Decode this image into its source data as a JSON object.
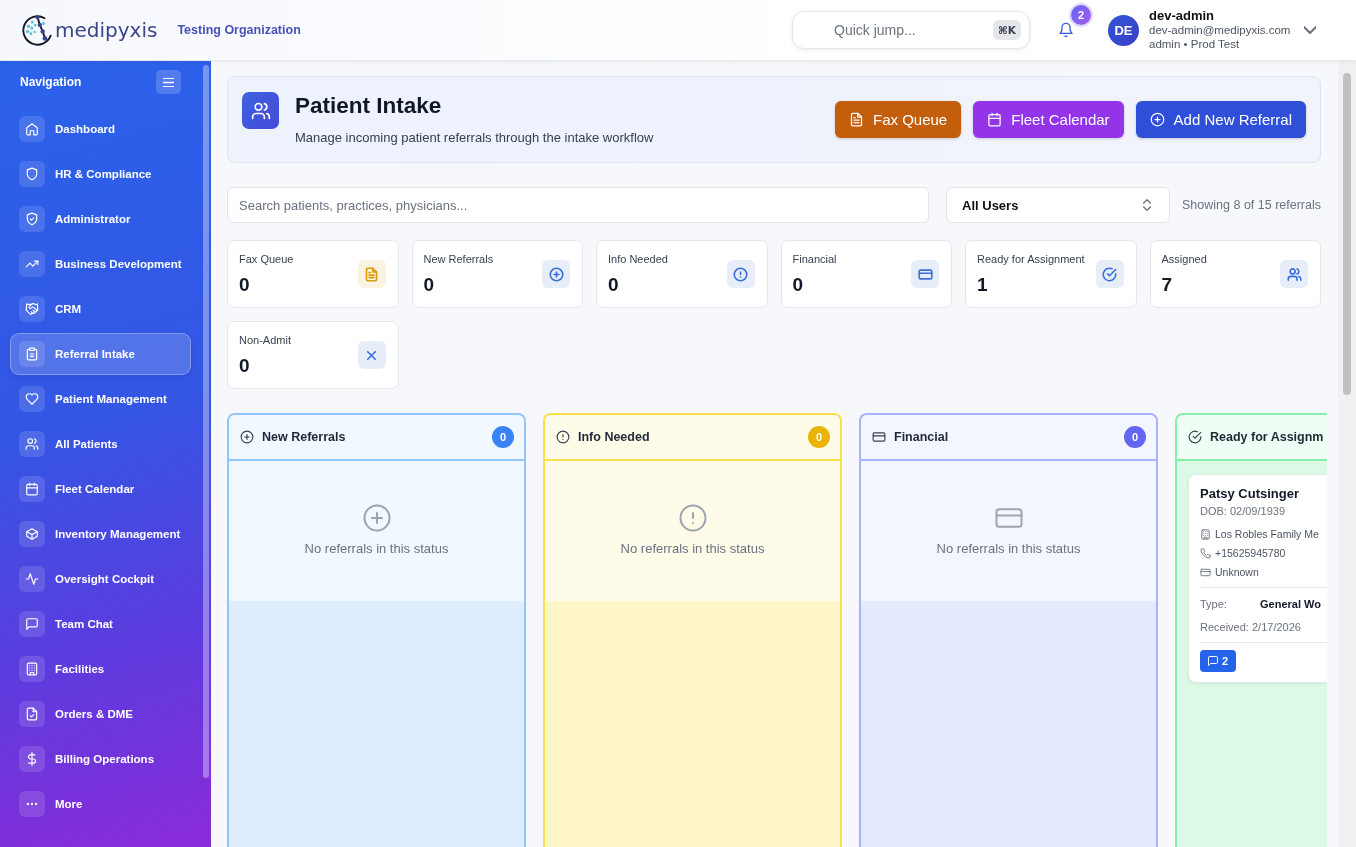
{
  "header": {
    "logo_text": "medipyxis",
    "organization": "Testing Organization",
    "quick_jump": {
      "placeholder": "Quick jump...",
      "shortcut": "⌘K"
    },
    "notifications": {
      "count": "2"
    },
    "user": {
      "initials": "DE",
      "name": "dev-admin",
      "email": "dev-admin@medipyxis.com",
      "role": "admin • Prod Test"
    }
  },
  "sidebar": {
    "title": "Navigation",
    "items": [
      {
        "label": "Dashboard",
        "selected": false
      },
      {
        "label": "HR & Compliance",
        "selected": false
      },
      {
        "label": "Administrator",
        "selected": false
      },
      {
        "label": "Business Development",
        "selected": false
      },
      {
        "label": "CRM",
        "selected": false
      },
      {
        "label": "Referral Intake",
        "selected": true
      },
      {
        "label": "Patient Management",
        "selected": false
      },
      {
        "label": "All Patients",
        "selected": false
      },
      {
        "label": "Fleet Calendar",
        "selected": false
      },
      {
        "label": "Inventory Management",
        "selected": false
      },
      {
        "label": "Oversight Cockpit",
        "selected": false
      },
      {
        "label": "Team Chat",
        "selected": false
      },
      {
        "label": "Facilities",
        "selected": false
      },
      {
        "label": "Orders & DME",
        "selected": false
      },
      {
        "label": "Billing Operations",
        "selected": false
      },
      {
        "label": "More",
        "selected": false
      }
    ]
  },
  "page_header": {
    "title": "Patient Intake",
    "subtitle": "Manage incoming patient referrals through the intake workflow",
    "buttons": [
      {
        "label": "Fax Queue",
        "color": "#c25e0c"
      },
      {
        "label": "Fleet Calendar",
        "color": "#9333ea"
      },
      {
        "label": "Add New Referral",
        "color": "#2f4fd9"
      }
    ]
  },
  "filters": {
    "search": {
      "placeholder": "Search patients, practices, physicians..."
    },
    "user_select": {
      "value": "All Users"
    },
    "result_count": "Showing 8 of 15 referrals"
  },
  "stats": [
    {
      "label": "Fax Queue",
      "value": "0",
      "color": "#d99a0b"
    },
    {
      "label": "New Referrals",
      "value": "0",
      "color": "#3b6fd6"
    },
    {
      "label": "Info Needed",
      "value": "0",
      "color": "#3b6fd6"
    },
    {
      "label": "Financial",
      "value": "0",
      "color": "#3b6fd6"
    },
    {
      "label": "Ready for Assignment",
      "value": "1",
      "color": "#3b6fd6"
    },
    {
      "label": "Assigned",
      "value": "7",
      "color": "#3b6fd6"
    },
    {
      "label": "Non-Admit",
      "value": "0",
      "color": "#3b6fd6"
    }
  ],
  "board": {
    "columns": [
      {
        "title": "New Referrals",
        "color": "#93c5fd",
        "count_badge": {
          "text": "0",
          "color": "#3b82f6"
        },
        "empty_text": "No referrals in this status"
      },
      {
        "title": "Info Needed",
        "color": "#fde047",
        "count_badge": {
          "text": "0",
          "color": "#eab308"
        },
        "empty_text": "No referrals in this status"
      },
      {
        "title": "Financial",
        "color": "#a5b4fc",
        "count_badge": {
          "text": "0",
          "color": "#6366f1"
        },
        "empty_text": "No referrals in this status"
      },
      {
        "title": "Ready for Assignm",
        "color": "#86efac",
        "cards": [
          {
            "name": "Patsy Cutsinger",
            "dob": "DOB: 02/09/1939",
            "practice": "Los Robles Family Me",
            "phone": "+15625945780",
            "insurance": "Unknown",
            "type_label": "Type:",
            "type_value": "General Wo",
            "received": "Received: 2/17/2026",
            "comments": "2"
          }
        ]
      }
    ]
  }
}
